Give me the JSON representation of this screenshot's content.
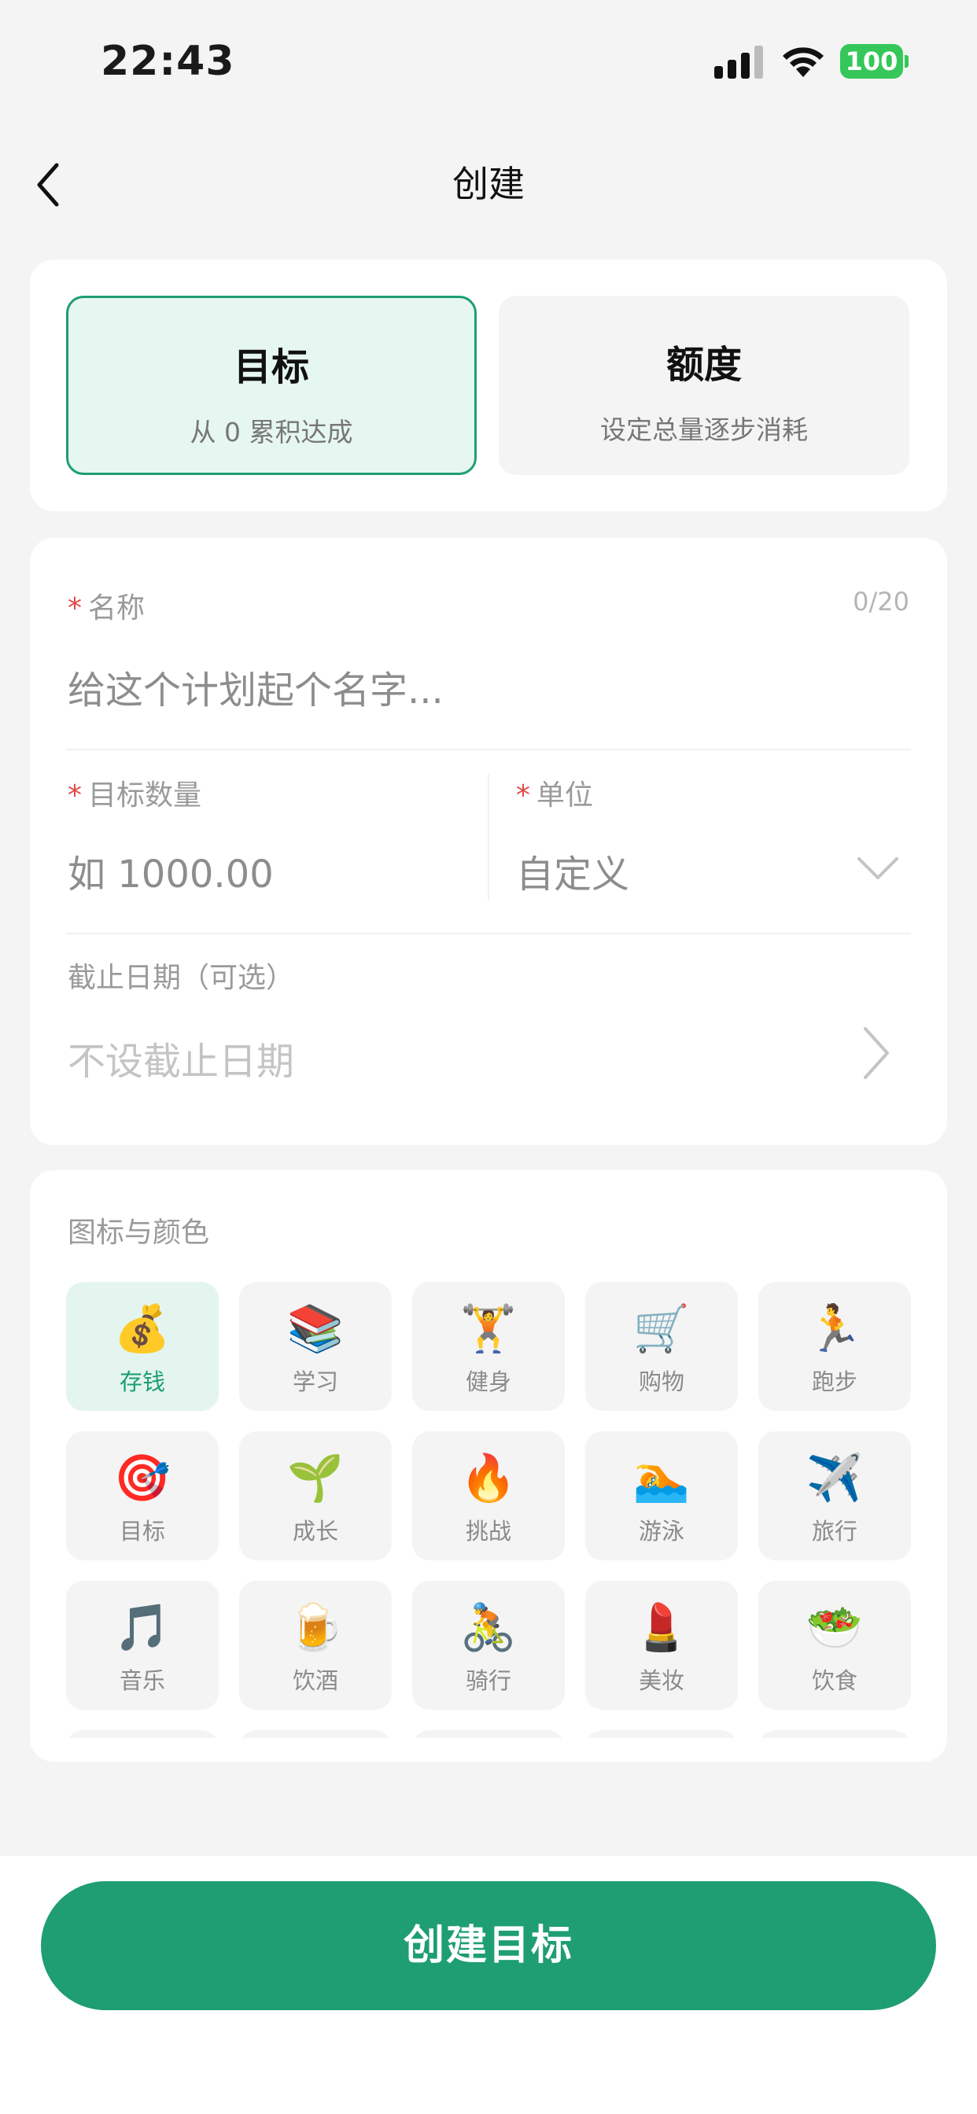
{
  "status_bar": {
    "time": "22:43",
    "battery": "100",
    "battery_color": "#35c759"
  },
  "nav": {
    "back_icon": "chevron-left-icon",
    "title": "创建"
  },
  "type_selector": {
    "selected": "goal",
    "options": [
      {
        "title": "目标",
        "subtitle": "从 0 累积达成"
      },
      {
        "title": "额度",
        "subtitle": "设定总量逐步消耗"
      }
    ]
  },
  "form": {
    "required_mark": "*",
    "name": {
      "label": "名称",
      "counter": "0/20",
      "placeholder": "给这个计划起个名字..."
    },
    "target_amount": {
      "label": "目标数量",
      "placeholder": "如 1000.00"
    },
    "unit": {
      "label": "单位",
      "value": "自定义"
    },
    "deadline": {
      "label": "截止日期（可选）",
      "value": "不设截止日期"
    }
  },
  "icons_section": {
    "label": "图标与颜色",
    "selected_index": 0,
    "items": [
      {
        "emoji": "💰",
        "name": "存钱"
      },
      {
        "emoji": "📚",
        "name": "学习"
      },
      {
        "emoji": "🏋️",
        "name": "健身"
      },
      {
        "emoji": "🛒",
        "name": "购物"
      },
      {
        "emoji": "🏃",
        "name": "跑步"
      },
      {
        "emoji": "🎯",
        "name": "目标"
      },
      {
        "emoji": "🌱",
        "name": "成长"
      },
      {
        "emoji": "🔥",
        "name": "挑战"
      },
      {
        "emoji": "🏊",
        "name": "游泳"
      },
      {
        "emoji": "✈️",
        "name": "旅行"
      },
      {
        "emoji": "🎵",
        "name": "音乐"
      },
      {
        "emoji": "🍺",
        "name": "饮酒"
      },
      {
        "emoji": "🚴",
        "name": "骑行"
      },
      {
        "emoji": "💄",
        "name": "美妆"
      },
      {
        "emoji": "🥗",
        "name": "饮食"
      }
    ]
  },
  "submit": {
    "label": "创建目标",
    "color": "#1e9e72"
  },
  "colors": {
    "accent": "#1e9e72",
    "required": "#e04848",
    "background": "#f4f4f4"
  }
}
